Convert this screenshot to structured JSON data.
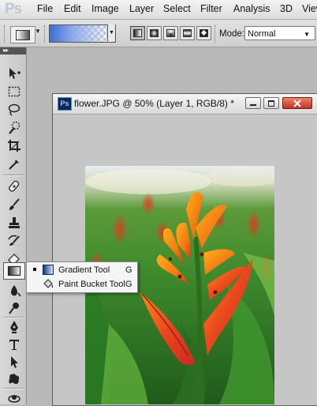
{
  "app": {
    "logo": "Ps"
  },
  "menu": [
    "File",
    "Edit",
    "Image",
    "Layer",
    "Select",
    "Filter",
    "Analysis",
    "3D",
    "View"
  ],
  "options": {
    "mode_label": "Mode:",
    "mode_value": "Normal",
    "gradient_types": [
      "linear-gradient-icon",
      "radial-gradient-icon",
      "angle-gradient-icon",
      "reflected-gradient-icon",
      "diamond-gradient-icon"
    ],
    "gradient_colors": {
      "start": "#3d6fd1",
      "end": "transparent"
    }
  },
  "toolbox": {
    "tools": [
      "move-tool-icon",
      "marquee-tool-icon",
      "lasso-tool-icon",
      "quick-selection-tool-icon",
      "crop-tool-icon",
      "eyedropper-tool-icon",
      "spot-healing-brush-icon",
      "brush-tool-icon",
      "clone-stamp-icon",
      "history-brush-icon",
      "eraser-tool-icon",
      "gradient-tool-icon",
      "blur-tool-icon",
      "dodge-tool-icon",
      "pen-tool-icon",
      "type-tool-icon",
      "path-selection-tool-icon",
      "custom-shape-tool-icon",
      "3d-rotate-tool-icon"
    ],
    "active_tool": "gradient-tool-icon"
  },
  "flyout": {
    "items": [
      {
        "label": "Gradient Tool",
        "shortcut": "G",
        "icon": "gradient-tool-icon",
        "selected": true
      },
      {
        "label": "Paint Bucket Tool",
        "shortcut": "G",
        "icon": "paint-bucket-icon",
        "selected": false
      }
    ]
  },
  "document": {
    "icon_text": "Ps",
    "title": "flower.JPG @ 50% (Layer 1, RGB/8) *"
  }
}
